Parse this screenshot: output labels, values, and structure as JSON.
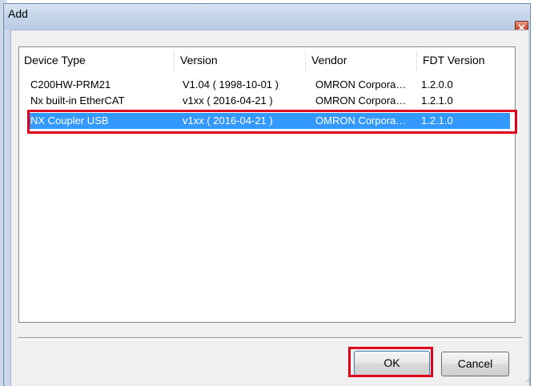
{
  "window": {
    "title": "Add"
  },
  "list": {
    "columns": [
      "Device Type",
      "Version",
      "Vendor",
      "FDT Version"
    ],
    "rows": [
      [
        "C200HW-PRM21",
        "V1.04 ( 1998-10-01 )",
        "OMRON Corpora…",
        "1.2.0.0"
      ],
      [
        "Nx built-in EtherCAT",
        "v1xx ( 2016-04-21 )",
        "OMRON Corpora…",
        "1.2.1.0"
      ],
      [
        "NX Coupler USB",
        "v1xx ( 2016-04-21 )",
        "OMRON Corpora…",
        "1.2.1.0"
      ]
    ],
    "selected_row": "NX Coupler USB"
  },
  "buttons": {
    "ok": "OK",
    "cancel": "Cancel"
  },
  "colors": {
    "selection": "#3399ff",
    "highlight": "#e0001b"
  }
}
